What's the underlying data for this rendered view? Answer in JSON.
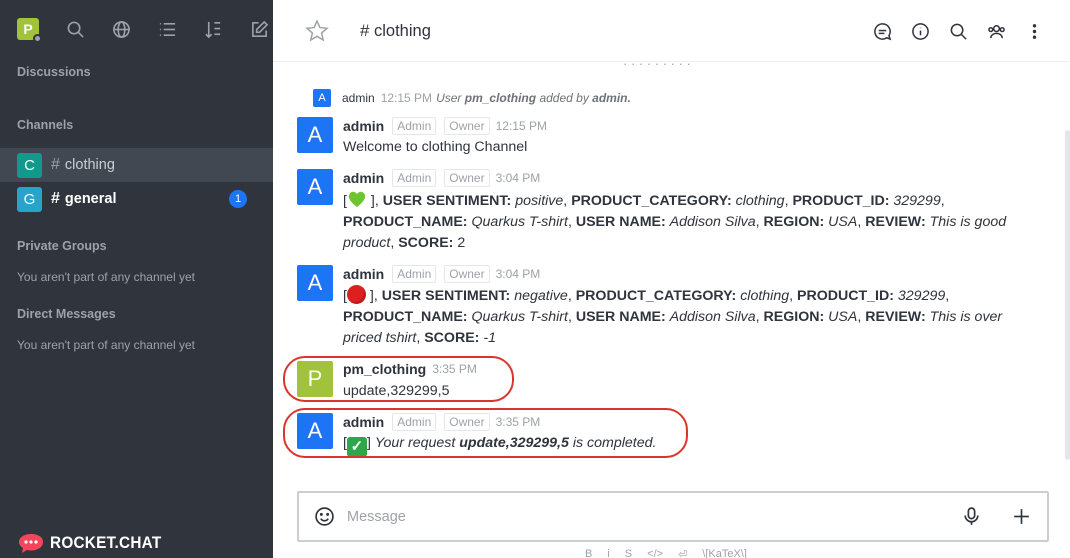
{
  "sidebar": {
    "user_initial": "P",
    "sections": {
      "discussions": "Discussions",
      "channels": "Channels",
      "private_groups": "Private Groups",
      "direct_messages": "Direct Messages"
    },
    "empty_private": "You aren't part of any channel yet",
    "empty_direct": "You aren't part of any channel yet",
    "channels": [
      {
        "initial": "C",
        "name": "clothing",
        "color": "#0f9a8c",
        "active": true
      },
      {
        "initial": "G",
        "name": "general",
        "color": "#26a4c9",
        "unread": "1"
      }
    ],
    "logo_text": "ROCKET.CHAT"
  },
  "header": {
    "channel_name": "clothing",
    "icons": [
      "discussion-icon",
      "info-icon",
      "search-icon",
      "members-icon",
      "kebab-menu-icon"
    ]
  },
  "messages": {
    "top_cut_text": "· · · · · · · · ·",
    "system": {
      "initial": "A",
      "user": "admin",
      "time": "12:15 PM",
      "text_pre": "User",
      "subject": "pm_clothing",
      "text_mid": "added by",
      "actor": "admin."
    },
    "list": [
      {
        "initial": "A",
        "user": "admin",
        "roles": [
          "Admin",
          "Owner"
        ],
        "time": "12:15 PM",
        "text": "Welcome to clothing Channel"
      },
      {
        "initial": "A",
        "user": "admin",
        "roles": [
          "Admin",
          "Owner"
        ],
        "time": "3:04 PM",
        "parts": {
          "open": "[",
          "close": "],",
          "k1": "USER SENTIMENT:",
          "v1": "positive",
          "k2": "PRODUCT_CATEGORY:",
          "v2": "clothing",
          "k3": "PRODUCT_ID:",
          "v3": "329299",
          "k4": "PRODUCT_NAME:",
          "v4": "Quarkus T-shirt",
          "k5": "USER NAME:",
          "v5": "Addison Silva",
          "k6": "REGION:",
          "v6": "USA",
          "k7": "REVIEW:",
          "v7": "This is good product",
          "k8": "SCORE:",
          "v8": "2"
        }
      },
      {
        "initial": "A",
        "user": "admin",
        "roles": [
          "Admin",
          "Owner"
        ],
        "time": "3:04 PM",
        "parts": {
          "open": "[",
          "close": "],",
          "k1": "USER SENTIMENT:",
          "v1": "negative",
          "k2": "PRODUCT_CATEGORY:",
          "v2": "clothing",
          "k3": "PRODUCT_ID:",
          "v3": "329299",
          "k4": "PRODUCT_NAME:",
          "v4": "Quarkus T-shirt",
          "k5": "USER NAME:",
          "v5": "Addison Silva",
          "k6": "REGION:",
          "v6": "USA",
          "k7": "REVIEW:",
          "v7": "This is over priced tshirt",
          "k8": "SCORE:",
          "v8": "-1"
        }
      },
      {
        "initial": "P",
        "user": "pm_clothing",
        "time": "3:35 PM",
        "text": "update,329299,5"
      },
      {
        "initial": "A",
        "user": "admin",
        "roles": [
          "Admin",
          "Owner"
        ],
        "time": "3:35 PM",
        "parts": {
          "open": "[",
          "close": "]",
          "pre": "Your request",
          "request": "update,329299,5",
          "post": "is completed."
        }
      }
    ]
  },
  "composer": {
    "placeholder": "Message",
    "formatting": [
      "B",
      "i",
      "S",
      "</>",
      "⏎",
      "\\[KaTeX\\]"
    ]
  },
  "colors": {
    "sidebar_bg": "#2f343d",
    "accent": "#1d74f5",
    "highlight": "#d9352b"
  }
}
